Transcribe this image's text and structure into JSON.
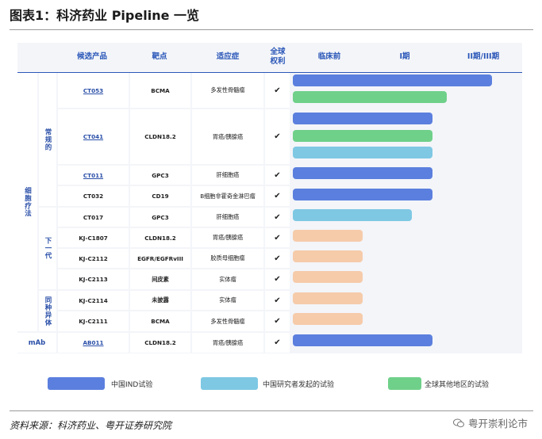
{
  "title": "图表1：科济药业 Pipeline 一览",
  "headers": {
    "candidate": "候选产品",
    "target": "靶点",
    "indication": "适应症",
    "rights": "全球\n权利",
    "preclinical": "临床前",
    "phase1": "I期",
    "phase2_3": "II期/III期"
  },
  "groups": {
    "cell_therapy": "细胞疗法",
    "autologous": "常规的",
    "next_gen": "下一代",
    "allogeneic": "同种异体",
    "mab": "mAb"
  },
  "rows": [
    {
      "candidate": "CT053",
      "target": "BCMA",
      "indication": "多发性骨髓瘤",
      "check": "✔"
    },
    {
      "candidate": "CT041",
      "target": "CLDN18.2",
      "indication": "胃癌/胰腺癌",
      "check": "✔"
    },
    {
      "candidate": "CT011",
      "target": "GPC3",
      "indication": "肝细胞癌",
      "check": "✔"
    },
    {
      "candidate": "CT032",
      "target": "CD19",
      "indication": "B细胞非霍奇金淋巴瘤",
      "check": "✔"
    },
    {
      "candidate": "CT017",
      "target": "GPC3",
      "indication": "肝细胞癌",
      "check": "✔"
    },
    {
      "candidate": "KJ-C1807",
      "target": "CLDN18.2",
      "indication": "胃癌/胰腺癌",
      "check": "✔"
    },
    {
      "candidate": "KJ-C2112",
      "target": "EGFR/EGFRvIII",
      "indication": "胶质母细胞瘤",
      "check": "✔"
    },
    {
      "candidate": "KJ-C2113",
      "target": "间皮素",
      "indication": "实体瘤",
      "check": "✔"
    },
    {
      "candidate": "KJ-C2114",
      "target": "未披露",
      "indication": "实体瘤",
      "check": "✔"
    },
    {
      "candidate": "KJ-C2111",
      "target": "BCMA",
      "indication": "多发性骨髓瘤",
      "check": "✔"
    },
    {
      "candidate": "AB011",
      "target": "CLDN18.2",
      "indication": "胃癌/胰腺癌",
      "check": "✔"
    }
  ],
  "bars": [
    {
      "program": "CT053",
      "trial": "china_ind",
      "stage_end": 2.85
    },
    {
      "program": "CT053",
      "trial": "global_other",
      "stage_end": 2.2
    },
    {
      "program": "CT041",
      "trial": "china_ind",
      "stage_end": 2.0
    },
    {
      "program": "CT041",
      "trial": "global_other",
      "stage_end": 2.0
    },
    {
      "program": "CT041",
      "trial": "investigator",
      "stage_end": 2.0
    },
    {
      "program": "CT011",
      "trial": "china_ind",
      "stage_end": 2.0
    },
    {
      "program": "CT032",
      "trial": "china_ind",
      "stage_end": 2.0
    },
    {
      "program": "CT017",
      "trial": "investigator",
      "stage_end": 1.7
    },
    {
      "program": "KJ-C1807",
      "trial": "preclinical",
      "stage_end": 1.0
    },
    {
      "program": "KJ-C2112",
      "trial": "preclinical",
      "stage_end": 1.0
    },
    {
      "program": "KJ-C2113",
      "trial": "preclinical",
      "stage_end": 1.0
    },
    {
      "program": "KJ-C2114",
      "trial": "preclinical",
      "stage_end": 1.0
    },
    {
      "program": "KJ-C2111",
      "trial": "preclinical",
      "stage_end": 1.0
    },
    {
      "program": "AB011",
      "trial": "china_ind",
      "stage_end": 2.0
    }
  ],
  "colors": {
    "china_ind": "#5b7fde",
    "investigator": "#7ec8e3",
    "global_other": "#6fd08a",
    "preclinical": "#f6cbaa"
  },
  "legend": {
    "china_ind": "中国IND试验",
    "investigator": "中国研究者发起的试验",
    "global_other": "全球其他地区的试验"
  },
  "footer": {
    "source": "资料来源：科济药业、粤开证券研究院",
    "watermark": "粤开崇利论市"
  }
}
